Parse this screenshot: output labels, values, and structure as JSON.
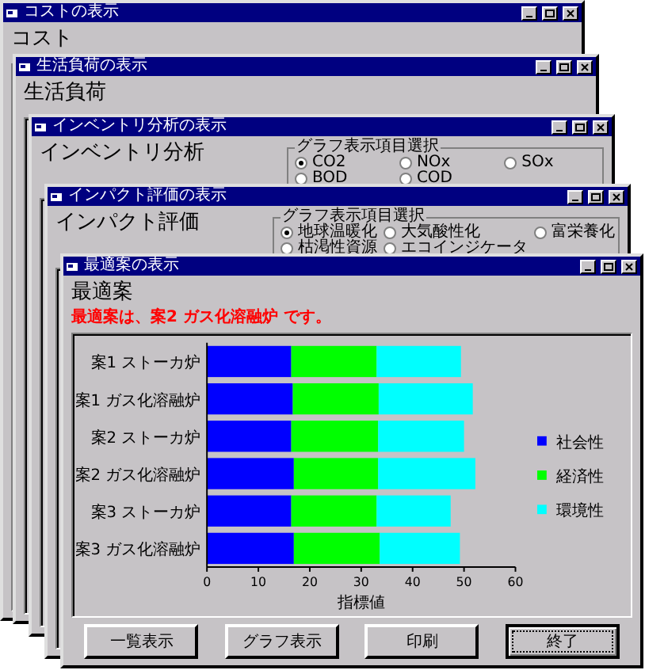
{
  "windows": [
    {
      "kind": "plain",
      "title": "コストの表示",
      "heading": "コスト"
    },
    {
      "kind": "plain",
      "title": "生活負荷の表示",
      "heading": "生活負荷"
    },
    {
      "kind": "options",
      "title": "インベントリ分析の表示",
      "heading": "インベントリ分析",
      "group": {
        "label": "グラフ表示項目選択",
        "options": [
          {
            "label": "CO2",
            "selected": true
          },
          {
            "label": "NOx",
            "selected": false
          },
          {
            "label": "SOx",
            "selected": false
          },
          {
            "label": "BOD",
            "selected": false
          },
          {
            "label": "COD",
            "selected": false
          }
        ]
      }
    },
    {
      "kind": "options",
      "title": "インパクト評価の表示",
      "heading": "インパクト評価",
      "group": {
        "label": "グラフ表示項目選択",
        "options": [
          {
            "label": "地球温暖化",
            "selected": true
          },
          {
            "label": "大気酸性化",
            "selected": false
          },
          {
            "label": "富栄養化",
            "selected": false
          },
          {
            "label": "枯渇性資源",
            "selected": false
          },
          {
            "label": "エコインジケータ",
            "selected": false
          }
        ]
      }
    },
    {
      "kind": "result",
      "title": "最適案の表示",
      "heading": "最適案",
      "message": "最適案は、案2 ガス化溶融炉 です。",
      "chart_data": {
        "type": "bar",
        "orientation": "horizontal",
        "stacked": true,
        "xlabel": "指標値",
        "categories": [
          "案1 ストーカ炉",
          "案1 ガス化溶融炉",
          "案2 ストーカ炉",
          "案2 ガス化溶融炉",
          "案3 ストーカ炉",
          "案3 ガス化溶融炉"
        ],
        "xlim": [
          0,
          60
        ],
        "legend": "right",
        "xticks": [
          0,
          10,
          20,
          30,
          40,
          50,
          60
        ],
        "series": [
          {
            "name": "社会性",
            "color": "#0000ff",
            "values": [
              16.4,
              16.7,
              16.4,
              16.9,
              16.4,
              16.9
            ]
          },
          {
            "name": "経済性",
            "color": "#00ff00",
            "values": [
              16.6,
              16.7,
              16.9,
              16.4,
              16.6,
              16.7
            ]
          },
          {
            "name": "環境性",
            "color": "#00ffff",
            "values": [
              16.4,
              18.3,
              16.7,
              18.9,
              14.4,
              15.6
            ]
          }
        ]
      },
      "buttons": [
        {
          "label": "一覧表示",
          "focused": false
        },
        {
          "label": "グラフ表示",
          "focused": false
        },
        {
          "label": "印刷",
          "focused": false
        },
        {
          "label": "終了",
          "focused": true
        }
      ]
    }
  ]
}
